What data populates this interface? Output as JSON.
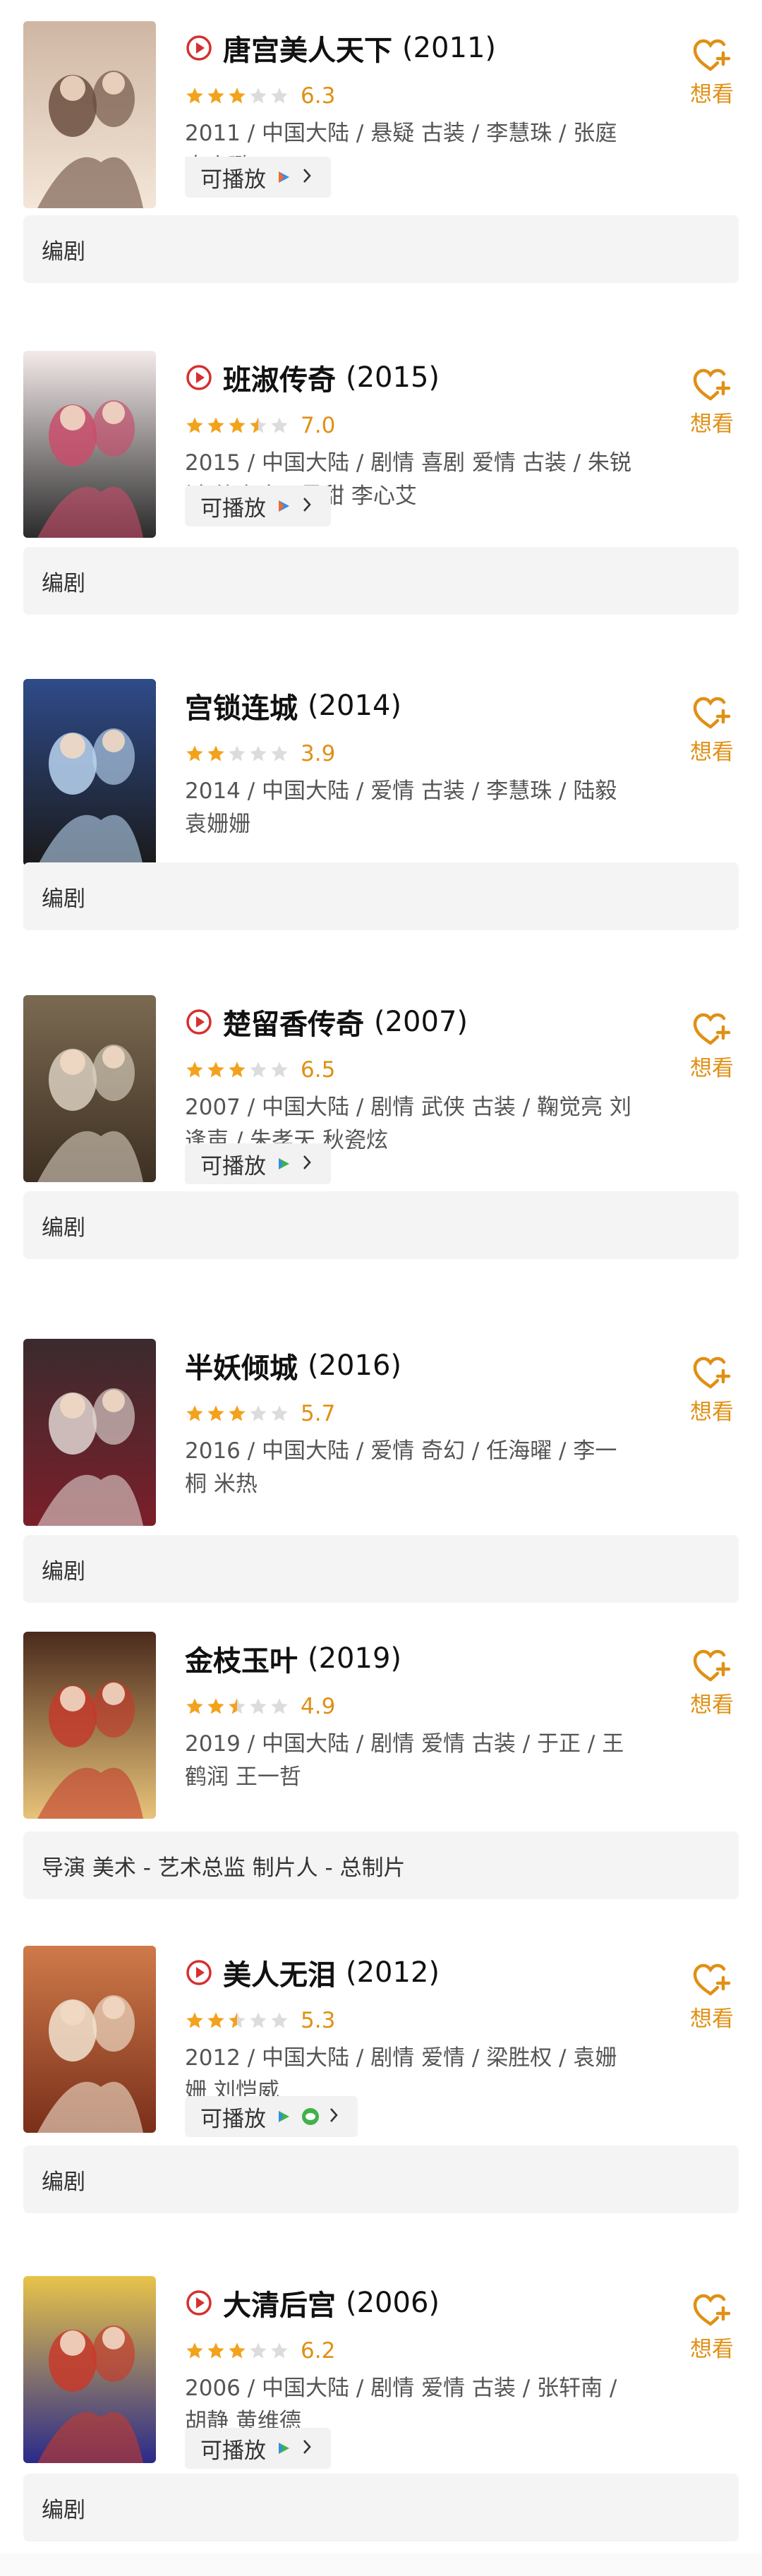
{
  "colors": {
    "accent": "#e09015",
    "play_icon": "#d62f2f",
    "star_on": "#f2a21b",
    "star_off": "#dcdcdc"
  },
  "icons": {
    "play": "play-circle-icon",
    "want": "heart-plus-icon",
    "star": "star-icon",
    "chevron": "chevron-right-icon"
  },
  "movies": [
    {
      "title": "唐宫美人天下",
      "year": "(2011)",
      "score": "6.3",
      "stars": 3,
      "half": false,
      "meta": "2011 / 中国大陆 / 悬疑 古装 / 李慧珠 / 张庭 李小璐",
      "playable": "可播放",
      "sources": [
        "tencent"
      ],
      "has_play_icon": true,
      "want": "想看",
      "role": "编剧"
    },
    {
      "title": "班淑传奇",
      "year": "(2015)",
      "score": "7.0",
      "stars": 3,
      "half": true,
      "meta": "2015 / 中国大陆 / 剧情 喜剧 爱情 古装 / 朱锐斌 徐惠康 / 景甜 李心艾",
      "playable": "可播放",
      "sources": [
        "tencent"
      ],
      "has_play_icon": true,
      "want": "想看",
      "role": "编剧"
    },
    {
      "title": "宫锁连城",
      "year": "(2014)",
      "score": "3.9",
      "stars": 2,
      "half": false,
      "meta": "2014 / 中国大陆 / 爱情 古装 / 李慧珠 / 陆毅 袁姗姗",
      "playable": "",
      "sources": [],
      "has_play_icon": false,
      "want": "想看",
      "role": "编剧"
    },
    {
      "title": "楚留香传奇",
      "year": "(2007)",
      "score": "6.5",
      "stars": 3,
      "half": false,
      "meta": "2007 / 中国大陆 / 剧情 武侠 古装 / 鞠觉亮 刘逢声 / 朱孝天 秋瓷炫",
      "playable": "可播放",
      "sources": [
        "iqiyi"
      ],
      "has_play_icon": true,
      "want": "想看",
      "role": "编剧"
    },
    {
      "title": "半妖倾城",
      "year": "(2016)",
      "score": "5.7",
      "stars": 3,
      "half": false,
      "meta": "2016 / 中国大陆 / 爱情 奇幻 / 任海曜 / 李一桐 米热",
      "playable": "",
      "sources": [],
      "has_play_icon": false,
      "want": "想看",
      "role": "编剧"
    },
    {
      "title": "金枝玉叶",
      "year": "(2019)",
      "score": "4.9",
      "stars": 2,
      "half": true,
      "meta": "2019 / 中国大陆 / 剧情 爱情 古装 / 于正 / 王鹤润 王一哲",
      "playable": "",
      "sources": [],
      "has_play_icon": false,
      "want": "想看",
      "role": "导演 美术 - 艺术总监 制片人 - 总制片"
    },
    {
      "title": "美人无泪",
      "year": "(2012)",
      "score": "5.3",
      "stars": 2,
      "half": true,
      "meta": "2012 / 中国大陆 / 剧情 爱情 / 梁胜权 / 袁姗姗 刘恺威",
      "playable": "可播放",
      "sources": [
        "iqiyi",
        "wechat"
      ],
      "has_play_icon": true,
      "want": "想看",
      "role": "编剧"
    },
    {
      "title": "大清后宫",
      "year": "(2006)",
      "score": "6.2",
      "stars": 3,
      "half": false,
      "meta": "2006 / 中国大陆 / 剧情 爱情 古装 / 张轩南 / 胡静 黄维德",
      "playable": "可播放",
      "sources": [
        "iqiyi"
      ],
      "has_play_icon": true,
      "want": "想看",
      "role": "编剧"
    }
  ]
}
